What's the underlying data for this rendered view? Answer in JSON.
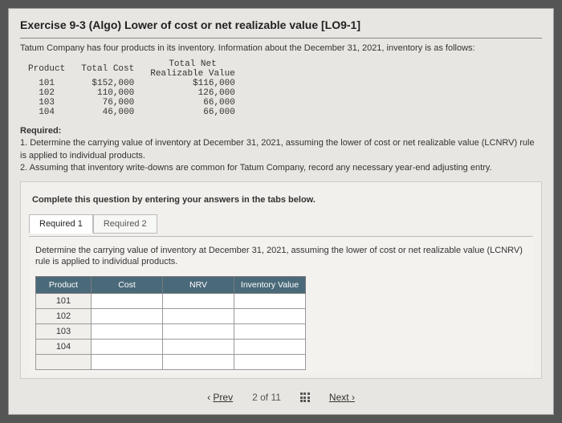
{
  "title": "Exercise 9-3 (Algo) Lower of cost or net realizable value [LO9-1]",
  "intro": "Tatum Company has four products in its inventory. Information about the December 31, 2021, inventory is as follows:",
  "data_headers": {
    "product": "Product",
    "total_cost": "Total Cost",
    "total_nrv": "Total Net\nRealizable Value"
  },
  "data_rows": [
    {
      "product": "101",
      "cost": "$152,000",
      "nrv": "$116,000"
    },
    {
      "product": "102",
      "cost": "110,000",
      "nrv": "126,000"
    },
    {
      "product": "103",
      "cost": "76,000",
      "nrv": "66,000"
    },
    {
      "product": "104",
      "cost": "46,000",
      "nrv": "66,000"
    }
  ],
  "required": {
    "header": "Required:",
    "item1": "1. Determine the carrying value of inventory at December 31, 2021, assuming the lower of cost or net realizable value (LCNRV) rule is applied to individual products.",
    "item2": "2. Assuming that inventory write-downs are common for Tatum Company, record any necessary year-end adjusting entry."
  },
  "panel": {
    "instruction": "Complete this question by entering your answers in the tabs below.",
    "tabs": [
      {
        "label": "Required 1",
        "active": true
      },
      {
        "label": "Required 2",
        "active": false
      }
    ],
    "tab1_desc": "Determine the carrying value of inventory at December 31, 2021, assuming the lower of cost or net realizable value (LCNRV) rule is applied to individual products.",
    "answer_headers": {
      "product": "Product",
      "cost": "Cost",
      "nrv": "NRV",
      "inv": "Inventory\nValue"
    },
    "answer_rows": [
      "101",
      "102",
      "103",
      "104"
    ]
  },
  "pager": {
    "prev": "Prev",
    "pos": "2 of 11",
    "next": "Next"
  }
}
